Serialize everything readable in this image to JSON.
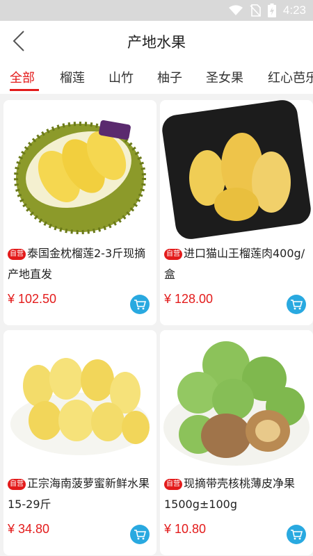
{
  "status_bar": {
    "time": "4:23",
    "icons": [
      "wifi-icon",
      "no-sim-icon",
      "battery-charging-icon"
    ]
  },
  "header": {
    "title": "产地水果",
    "back_icon": "chevron-left-icon"
  },
  "tabs": [
    {
      "label": "全部",
      "active": true
    },
    {
      "label": "榴莲",
      "active": false
    },
    {
      "label": "山竹",
      "active": false
    },
    {
      "label": "柚子",
      "active": false
    },
    {
      "label": "圣女果",
      "active": false
    },
    {
      "label": "红心芭乐",
      "active": false
    }
  ],
  "products": [
    {
      "badge": "自营",
      "title": "泰国金枕榴莲2-3斤现摘产地直发",
      "price": "¥ 102.50",
      "image": "durian-whole"
    },
    {
      "badge": "自营",
      "title": "进口猫山王榴莲肉400g/盒",
      "price": "¥ 128.00",
      "image": "durian-flesh-box"
    },
    {
      "badge": "自营",
      "title": "正宗海南菠萝蜜新鲜水果15-29斤",
      "price": "¥ 34.80",
      "image": "jackfruit-pods"
    },
    {
      "badge": "自营",
      "title": "现摘带壳核桃薄皮净果1500g±100g",
      "price": "¥ 10.80",
      "image": "green-walnuts"
    }
  ],
  "colors": {
    "accent": "#e31b1b",
    "cart": "#29a9e0"
  }
}
